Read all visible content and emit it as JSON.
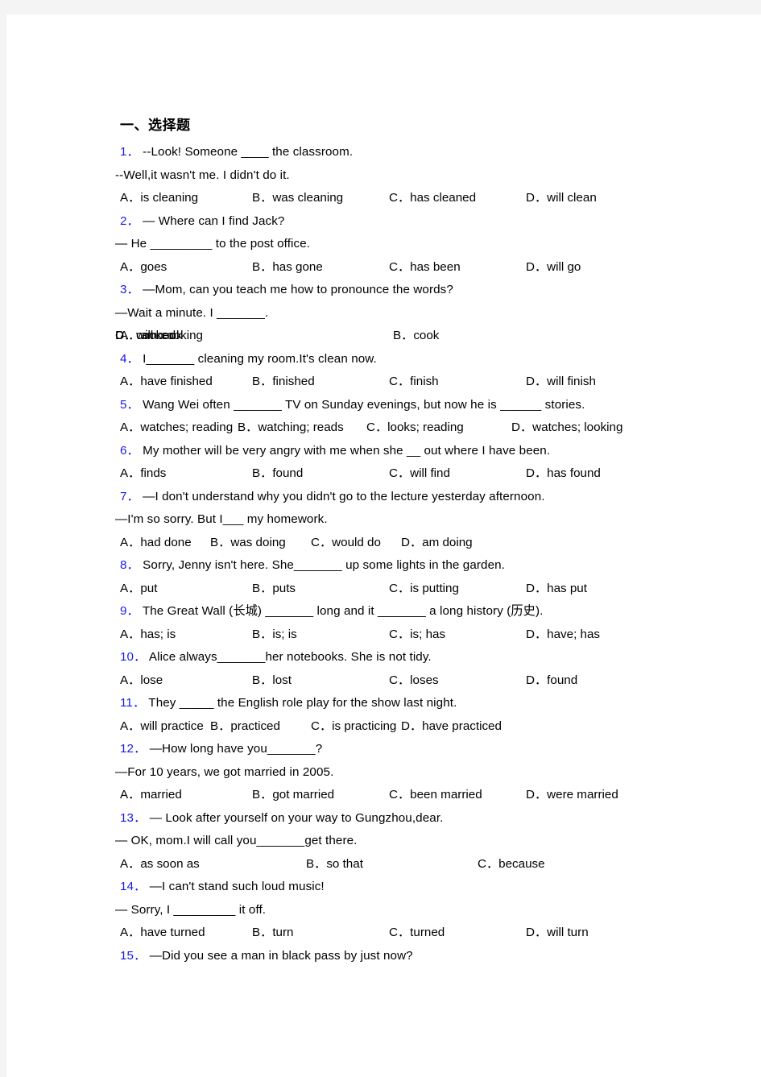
{
  "document": {
    "section_title": "一、选择题",
    "questions": [
      {
        "num": "1．",
        "lines": [
          "--Look! Someone  ____  the classroom.",
          "--Well,it wasn't me. I didn't do it."
        ],
        "options": [
          "A．is cleaning",
          "B．was cleaning",
          "C．has cleaned",
          "D．will clean"
        ],
        "layout": "cols4"
      },
      {
        "num": "2．",
        "lines": [
          "— Where can I find Jack?",
          "— He _________ to the post office."
        ],
        "options": [
          "A．goes",
          "B．has gone",
          "C．has been",
          "D．will go"
        ],
        "layout": "cols4"
      },
      {
        "num": "3．",
        "lines": [
          "—Mom, can you teach me how to pronounce the words?",
          "—Wait a minute. I _______."
        ],
        "options": [
          "A．am cooking",
          "B．cook",
          "C．cooked",
          "D．will cook"
        ],
        "layout": "cols2"
      },
      {
        "num": "4．",
        "lines": [
          "I_______ cleaning my room.It's clean now."
        ],
        "options": [
          "A．have finished",
          "B．finished",
          "C．finish",
          "D．will finish"
        ],
        "layout": "cols4"
      },
      {
        "num": "5．",
        "lines": [
          "Wang Wei often _______ TV on Sunday evenings, but now he is ______ stories."
        ],
        "options": [
          "A．watches; reading",
          "B．watching; reads",
          "C．looks; reading",
          "D．watches; looking"
        ],
        "layout": "cols4w"
      },
      {
        "num": "6．",
        "lines": [
          "My mother will be very angry with me when she  __ out where I have been."
        ],
        "options": [
          "A．finds",
          "B．found",
          "C．will find",
          "D．has found"
        ],
        "layout": "cols4"
      },
      {
        "num": "7．",
        "lines": [
          "—I don't understand why you didn't go to the lecture yesterday afternoon.",
          "—I'm so sorry. But I___  my homework."
        ],
        "options": [
          "A．had done",
          "B．was doing",
          "C．would do",
          "D．am doing"
        ],
        "layout": "cols4c"
      },
      {
        "num": "8．",
        "lines": [
          "Sorry, Jenny isn't here. She_______ up some lights in the garden."
        ],
        "options": [
          "A．put",
          "B．puts",
          "C．is putting",
          "D．has put"
        ],
        "layout": "cols4"
      },
      {
        "num": "9．",
        "lines": [
          "The Great Wall (长城) _______ long and it  _______ a long history (历史)."
        ],
        "options": [
          "A．has; is",
          "B．is; is",
          "C．is; has",
          "D．have; has"
        ],
        "layout": "cols4"
      },
      {
        "num": "10．",
        "lines": [
          "Alice always_______her notebooks. She is not tidy."
        ],
        "options": [
          "A．lose",
          "B．lost",
          "C．loses",
          "D．found"
        ],
        "layout": "cols4"
      },
      {
        "num": "11．",
        "lines": [
          "They _____   the English role play for the show last night."
        ],
        "options": [
          "A．will practice",
          "B．practiced",
          "C．is practicing",
          "D．have practiced"
        ],
        "layout": "cols4c"
      },
      {
        "num": "12．",
        "lines": [
          "—How long have you_______?",
          "—For 10 years, we got married in 2005."
        ],
        "options": [
          "A．married",
          "B．got married",
          "C．been married",
          "D．were married"
        ],
        "layout": "cols4"
      },
      {
        "num": "13．",
        "lines": [
          "— Look after yourself on your way to Gungzhou,dear.",
          "— OK, mom.I will call you_______get there."
        ],
        "options": [
          "A．as soon as",
          "B．so that",
          "C．because"
        ],
        "layout": "cols3"
      },
      {
        "num": "14．",
        "lines": [
          "—I can't stand such loud music!",
          "— Sorry, I _________ it off."
        ],
        "options": [
          "A．have turned",
          "B．turn",
          "C．turned",
          "D．will turn"
        ],
        "layout": "cols4"
      },
      {
        "num": "15．",
        "lines": [
          "—Did you see a man in black pass by just now?"
        ],
        "options": [],
        "layout": "cols4"
      }
    ]
  },
  "colors": {
    "page_background": "#ffffff",
    "canvas_background": "#f4f4f4",
    "question_number": "#1a1ae8",
    "text": "#000000"
  }
}
